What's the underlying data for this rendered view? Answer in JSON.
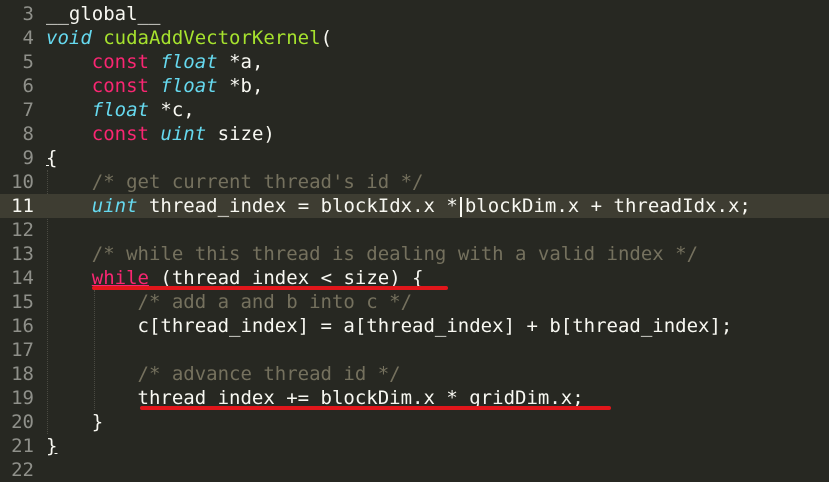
{
  "editor": {
    "line_numbers": [
      "3",
      "4",
      "5",
      "6",
      "7",
      "8",
      "9",
      "10",
      "11",
      "12",
      "13",
      "14",
      "15",
      "16",
      "17",
      "18",
      "19",
      "20",
      "21",
      "22"
    ],
    "active_line": "11",
    "code": {
      "l3": "__global__",
      "l4_type": "void",
      "l4_func": "cudaAddVectorKernel",
      "l4_paren": "(",
      "l5_kw": "const",
      "l5_type": "float",
      "l5_rest": "*a,",
      "l6_kw": "const",
      "l6_type": "float",
      "l6_rest": "*b,",
      "l7_type": "float",
      "l7_rest": "*c,",
      "l8_kw": "const",
      "l8_type": "uint",
      "l8_rest": "size)",
      "l9": "{",
      "l10": "/* get current thread's id */",
      "l11_type": "uint",
      "l11_a": "thread_index = blockIdx.x *",
      "l11_b": "blockDim.x + threadIdx.x;",
      "l13": "/* while this thread is dealing with a valid index */",
      "l14_kw": "while",
      "l14_rest": "(thread_index < size) {",
      "l15": "/* add a and b into c */",
      "l16": "c[thread_index] = a[thread_index] + b[thread_index];",
      "l18": "/* advance thread id */",
      "l19": "thread_index += blockDim.x * gridDim.x;",
      "l20": "}",
      "l21": "}"
    },
    "annotation_color": "#E1161B"
  }
}
